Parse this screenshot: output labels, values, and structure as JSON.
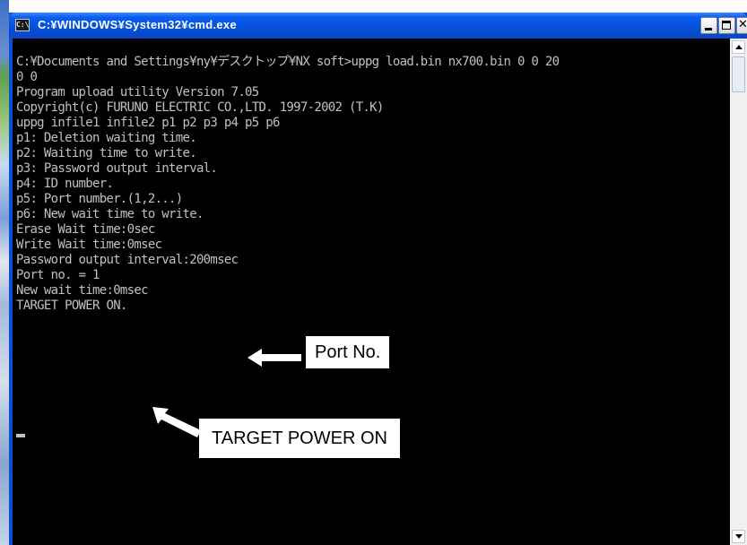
{
  "window": {
    "title": "C:¥WINDOWS¥System32¥cmd.exe",
    "icon": "console-icon",
    "icon_text": "C:\\"
  },
  "console": {
    "lines": [
      "C:¥Documents and Settings¥ny¥デスクトップ¥NX soft>uppg load.bin nx700.bin 0 0 20",
      "0 0",
      "Program upload utility Version 7.05",
      "Copyright(c) FURUNO ELECTRIC CO.,LTD. 1997-2002 (T.K)",
      "uppg infile1 infile2 p1 p2 p3 p4 p5 p6",
      "p1: Deletion waiting time.",
      "p2: Waiting time to write.",
      "p3: Password output interval.",
      "p4: ID number.",
      "p5: Port number.(1,2...)",
      "p6: New wait time to write.",
      "Erase Wait time:0sec",
      "Write Wait time:0msec",
      "Password output interval:200msec",
      "Port no. = 1",
      "New wait time:0msec",
      "TARGET POWER ON."
    ]
  },
  "callouts": {
    "port_no": "Port No.",
    "target_power_on": "TARGET POWER ON"
  },
  "colors": {
    "titlebar": "#0550dc",
    "console_bg": "#000000",
    "console_text": "#c0c0c0"
  }
}
